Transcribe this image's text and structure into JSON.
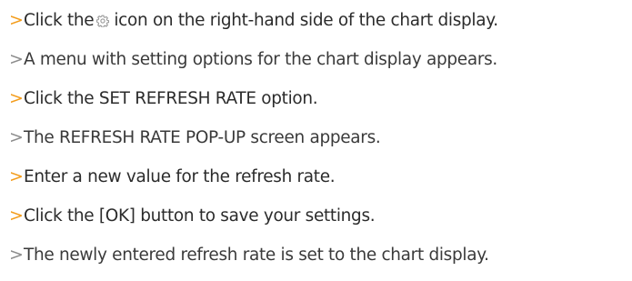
{
  "marker": ">",
  "steps": [
    {
      "type": "action",
      "before": "Click the",
      "icon": "gear-icon",
      "after": "icon on the right-hand side of the chart display."
    },
    {
      "type": "result",
      "text": "A menu with setting options for the chart display appears."
    },
    {
      "type": "action",
      "text": "Click the SET REFRESH RATE option."
    },
    {
      "type": "result",
      "text": "The REFRESH RATE POP-UP screen appears."
    },
    {
      "type": "action",
      "text": "Enter a new value for the refresh rate."
    },
    {
      "type": "action",
      "text": "Click the [OK] button to save your settings."
    },
    {
      "type": "result",
      "text": "The newly entered refresh rate is set to the chart display."
    }
  ],
  "colors": {
    "action_marker": "#f39c1b",
    "result_marker": "#8c8c8c",
    "text": "#2b2b2b"
  }
}
